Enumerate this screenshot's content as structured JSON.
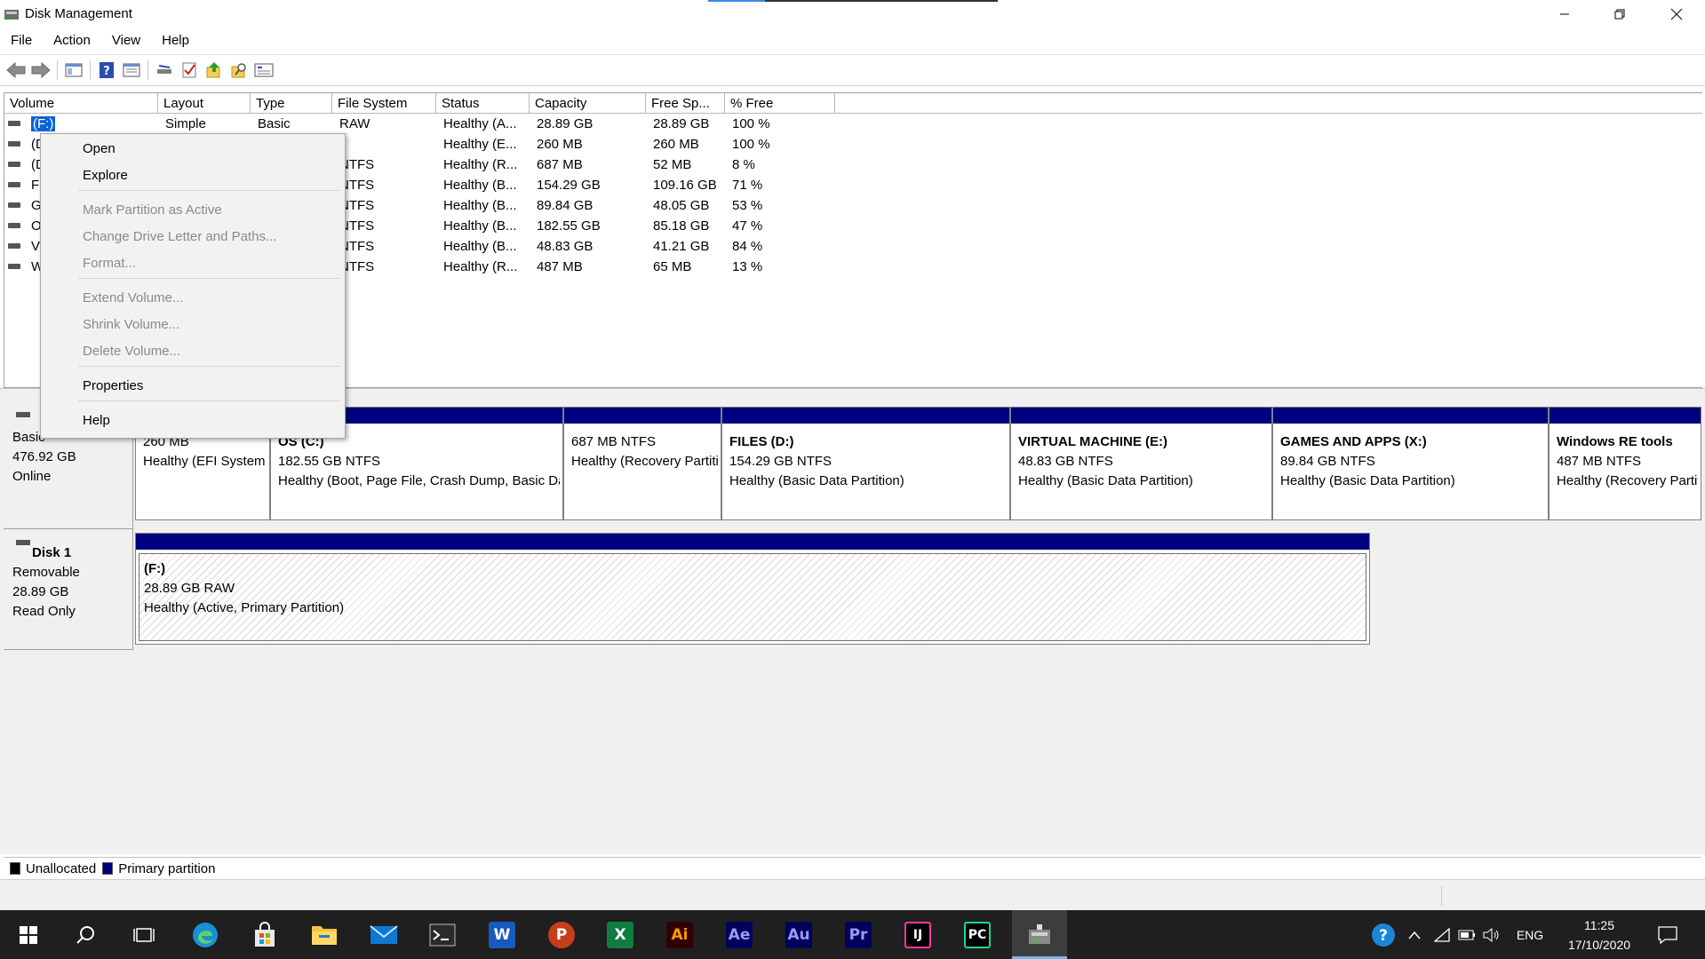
{
  "window": {
    "title": "Disk Management",
    "controls": [
      "minimize",
      "restore",
      "close"
    ]
  },
  "menu": [
    "File",
    "Action",
    "View",
    "Help"
  ],
  "toolbar": {
    "icons": [
      "back-arrow-icon",
      "forward-arrow-icon",
      "console-tree-icon",
      "help-icon",
      "properties-icon",
      "connect-icon",
      "check-icon",
      "export-icon",
      "search-folder-icon",
      "settings-panel-icon"
    ]
  },
  "volume_list": {
    "columns": [
      "Volume",
      "Layout",
      "Type",
      "File System",
      "Status",
      "Capacity",
      "Free Sp...",
      "% Free"
    ],
    "rows": [
      {
        "volume": "(F:)",
        "layout": "Simple",
        "type": "Basic",
        "fs": "RAW",
        "status": "Healthy (A...",
        "capacity": "28.89 GB",
        "free": "28.89 GB",
        "pct": "100 %"
      },
      {
        "volume": "(D",
        "layout": "",
        "type": "",
        "fs": "",
        "status": "Healthy (E...",
        "capacity": "260 MB",
        "free": "260 MB",
        "pct": "100 %"
      },
      {
        "volume": "(D",
        "layout": "",
        "type": "",
        "fs": "NTFS",
        "status": "Healthy (R...",
        "capacity": "687 MB",
        "free": "52 MB",
        "pct": "8 %"
      },
      {
        "volume": "FII",
        "layout": "",
        "type": "",
        "fs": "NTFS",
        "status": "Healthy (B...",
        "capacity": "154.29 GB",
        "free": "109.16 GB",
        "pct": "71 %"
      },
      {
        "volume": "GA",
        "layout": "",
        "type": "",
        "fs": "NTFS",
        "status": "Healthy (B...",
        "capacity": "89.84 GB",
        "free": "48.05 GB",
        "pct": "53 %"
      },
      {
        "volume": "OS",
        "layout": "",
        "type": "",
        "fs": "NTFS",
        "status": "Healthy (B...",
        "capacity": "182.55 GB",
        "free": "85.18 GB",
        "pct": "47 %"
      },
      {
        "volume": "VI",
        "layout": "",
        "type": "",
        "fs": "NTFS",
        "status": "Healthy (B...",
        "capacity": "48.83 GB",
        "free": "41.21 GB",
        "pct": "84 %"
      },
      {
        "volume": "W",
        "layout": "",
        "type": "",
        "fs": "NTFS",
        "status": "Healthy (R...",
        "capacity": "487 MB",
        "free": "65 MB",
        "pct": "13 %"
      }
    ]
  },
  "context_menu": {
    "items": [
      {
        "label": "Open",
        "enabled": true
      },
      {
        "label": "Explore",
        "enabled": true
      },
      {
        "label": "Mark Partition as Active",
        "enabled": false
      },
      {
        "label": "Change Drive Letter and Paths...",
        "enabled": false
      },
      {
        "label": "Format...",
        "enabled": false
      },
      {
        "label": "Extend Volume...",
        "enabled": false
      },
      {
        "label": "Shrink Volume...",
        "enabled": false
      },
      {
        "label": "Delete Volume...",
        "enabled": false
      },
      {
        "label": "Properties",
        "enabled": true
      },
      {
        "label": "Help",
        "enabled": true
      }
    ]
  },
  "disk0": {
    "type": "Basic",
    "size": "476.92 GB",
    "state": "Online",
    "partitions": [
      {
        "name": "",
        "size_fs": "260 MB",
        "status": "Healthy (EFI System Partition)"
      },
      {
        "name": "OS  (C:)",
        "size_fs": "182.55 GB NTFS",
        "status": "Healthy (Boot, Page File, Crash Dump, Basic Data Partition)"
      },
      {
        "name": "",
        "size_fs": "687 MB NTFS",
        "status": "Healthy (Recovery Partition)"
      },
      {
        "name": "FILES  (D:)",
        "size_fs": "154.29 GB NTFS",
        "status": "Healthy (Basic Data Partition)"
      },
      {
        "name": "VIRTUAL MACHINE  (E:)",
        "size_fs": "48.83 GB NTFS",
        "status": "Healthy (Basic Data Partition)"
      },
      {
        "name": "GAMES AND APPS  (X:)",
        "size_fs": "89.84 GB NTFS",
        "status": "Healthy (Basic Data Partition)"
      },
      {
        "name": "Windows RE tools",
        "size_fs": "487 MB NTFS",
        "status": "Healthy (Recovery Partition)"
      }
    ]
  },
  "disk1": {
    "name": "Disk 1",
    "type": "Removable",
    "size": "28.89 GB",
    "state": "Read Only",
    "partition": {
      "name": "(F:)",
      "size_fs": "28.89 GB RAW",
      "status": "Healthy (Active, Primary Partition)"
    }
  },
  "legend": [
    {
      "label": "Unallocated",
      "color": "#000000"
    },
    {
      "label": "Primary partition",
      "color": "#000080"
    }
  ],
  "taskbar": {
    "apps": [
      {
        "name": "start",
        "label": ""
      },
      {
        "name": "search",
        "label": ""
      },
      {
        "name": "task-view",
        "label": ""
      },
      {
        "name": "edge",
        "label": ""
      },
      {
        "name": "store",
        "label": ""
      },
      {
        "name": "file-explorer",
        "label": ""
      },
      {
        "name": "mail",
        "label": ""
      },
      {
        "name": "terminal",
        "label": ""
      },
      {
        "name": "word",
        "label": "W"
      },
      {
        "name": "powerpoint",
        "label": "P"
      },
      {
        "name": "excel",
        "label": "X"
      },
      {
        "name": "illustrator",
        "label": "Ai"
      },
      {
        "name": "after-effects",
        "label": "Ae"
      },
      {
        "name": "audition",
        "label": "Au"
      },
      {
        "name": "premiere",
        "label": "Pr"
      },
      {
        "name": "intellij",
        "label": "IJ"
      },
      {
        "name": "pycharm",
        "label": "PC"
      },
      {
        "name": "disk-management",
        "label": ""
      }
    ],
    "tray": {
      "language": "ENG",
      "time": "11:25",
      "date": "17/10/2020"
    }
  },
  "colors": {
    "primary_partition": "#000080",
    "selection": "#0a64d8",
    "taskbar": "#1f1f1f"
  }
}
